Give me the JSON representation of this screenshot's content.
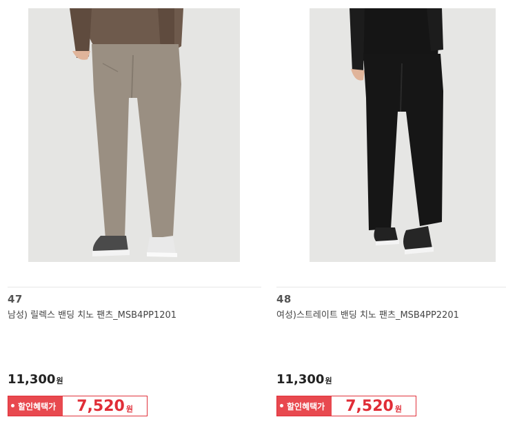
{
  "products": [
    {
      "rank": "47",
      "name": "남성) 릴렉스 밴딩 치노 팬츠_MSB4PP1201",
      "price": "11,300",
      "currency": "원",
      "discount_label": "할인혜택가",
      "discount_price": "7,520",
      "discount_currency": "원",
      "pants_color": "#9a8f82"
    },
    {
      "rank": "48",
      "name": "여성)스트레이트 밴딩 치노 팬츠_MSB4PP2201",
      "price": "11,300",
      "currency": "원",
      "discount_label": "할인혜택가",
      "discount_price": "7,520",
      "discount_currency": "원",
      "pants_color": "#161616"
    }
  ],
  "colors": {
    "accent": "#e8494f",
    "discount_text": "#e02d37"
  }
}
